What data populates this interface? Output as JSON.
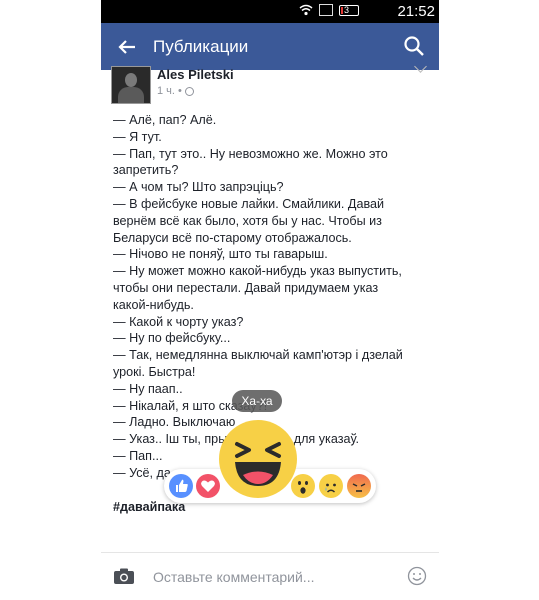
{
  "status": {
    "time": "21:52",
    "battery_level": "3",
    "battery_color": "#e53935"
  },
  "appbar": {
    "title": "Публикации",
    "color": "#3b5998"
  },
  "post": {
    "author": "Ales Piletski",
    "time": "1 ч.",
    "lines": [
      "— Алё, пап? Алё.",
      "— Я тут.",
      "— Пап, тут это.. Ну невозможно же. Можно это",
      "запретить?",
      "— А чом ты? Што запрэціць?",
      "— В фейсбуке новые лайки. Смайлики. Давай",
      "вернём всё как было, хотя бы у нас. Чтобы из",
      "Беларуси всё по-старому отображалось.",
      "— Нічово не поняў, што ты гаварыш.",
      "— Ну может можно какой-нибудь указ выпустить,",
      "чтобы они перестали. Давай придумаем указ",
      "какой-нибудь.",
      "— Какой к чорту указ?",
      "— Ну по фейсбуку...",
      "— Так, немедлянна выключай камп'ютэр і дзелай",
      "урокі. Быстра!",
      "— Ну паап..",
      "— Нікалай, я што сказаў?!",
      "— Ладно. Выключаю",
      "— Указ.. Іш ты, пры... ты ешчо для указаў.",
      "— Пап...",
      "— Усё, да..."
    ],
    "hashtag": "#давайпака"
  },
  "reaction_picker": {
    "tooltip": "Ха-ха",
    "items": [
      "like",
      "love",
      "haha",
      "wow",
      "sad",
      "angry"
    ],
    "highlighted": "haha"
  },
  "composer": {
    "placeholder": "Оставьте комментарий..."
  }
}
